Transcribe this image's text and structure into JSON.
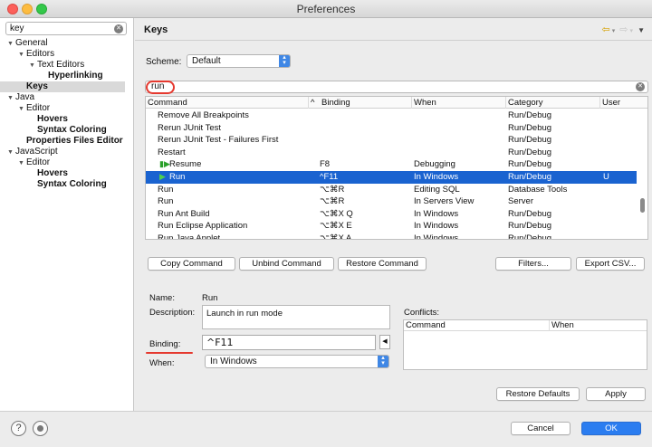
{
  "window": {
    "title": "Preferences"
  },
  "left": {
    "filter_value": "key",
    "tree": [
      {
        "label": "General",
        "indent": 0,
        "tri": "▼",
        "bold": false
      },
      {
        "label": "Editors",
        "indent": 1,
        "tri": "▼",
        "bold": false
      },
      {
        "label": "Text Editors",
        "indent": 2,
        "tri": "▼",
        "bold": false
      },
      {
        "label": "Hyperlinking",
        "indent": 3,
        "tri": "",
        "bold": true
      },
      {
        "label": "Keys",
        "indent": 1,
        "tri": "",
        "bold": true
      },
      {
        "label": "Java",
        "indent": 0,
        "tri": "▼",
        "bold": false
      },
      {
        "label": "Editor",
        "indent": 1,
        "tri": "▼",
        "bold": false
      },
      {
        "label": "Hovers",
        "indent": 2,
        "tri": "",
        "bold": true
      },
      {
        "label": "Syntax Coloring",
        "indent": 2,
        "tri": "",
        "bold": true
      },
      {
        "label": "Properties Files Editor",
        "indent": 1,
        "tri": "",
        "bold": true
      },
      {
        "label": "JavaScript",
        "indent": 0,
        "tri": "▼",
        "bold": false
      },
      {
        "label": "Editor",
        "indent": 1,
        "tri": "▼",
        "bold": false
      },
      {
        "label": "Hovers",
        "indent": 2,
        "tri": "",
        "bold": true
      },
      {
        "label": "Syntax Coloring",
        "indent": 2,
        "tri": "",
        "bold": true
      }
    ]
  },
  "main": {
    "title": "Keys",
    "scheme_label": "Scheme:",
    "scheme_value": "Default",
    "search_value": "run",
    "columns": [
      "Command",
      "Binding",
      "When",
      "Category",
      "User"
    ],
    "rows": [
      {
        "command": "Remove All Breakpoints",
        "binding": "",
        "when": "",
        "category": "Run/Debug",
        "user": ""
      },
      {
        "command": "Rerun JUnit Test",
        "binding": "",
        "when": "",
        "category": "Run/Debug",
        "user": ""
      },
      {
        "command": "Rerun JUnit Test - Failures First",
        "binding": "",
        "when": "",
        "category": "Run/Debug",
        "user": ""
      },
      {
        "command": "Restart",
        "binding": "",
        "when": "",
        "category": "Run/Debug",
        "user": ""
      },
      {
        "command": "Resume",
        "binding": "F8",
        "when": "Debugging",
        "category": "Run/Debug",
        "user": ""
      },
      {
        "command": "Run",
        "binding": "^F11",
        "when": "In Windows",
        "category": "Run/Debug",
        "user": "U"
      },
      {
        "command": "Run",
        "binding": "⌥⌘R",
        "when": "Editing SQL",
        "category": "Database Tools",
        "user": ""
      },
      {
        "command": "Run",
        "binding": "⌥⌘R",
        "when": "In Servers View",
        "category": "Server",
        "user": ""
      },
      {
        "command": "Run Ant Build",
        "binding": "⌥⌘X Q",
        "when": "In Windows",
        "category": "Run/Debug",
        "user": ""
      },
      {
        "command": "Run Eclipse Application",
        "binding": "⌥⌘X E",
        "when": "In Windows",
        "category": "Run/Debug",
        "user": ""
      },
      {
        "command": "Run Java Applet",
        "binding": "⌥⌘X A",
        "when": "In Windows",
        "category": "Run/Debug",
        "user": ""
      }
    ],
    "buttons": {
      "copy_command": "Copy Command",
      "unbind_command": "Unbind Command",
      "restore_command": "Restore Command",
      "filters": "Filters...",
      "export_csv": "Export CSV..."
    },
    "details": {
      "name_label": "Name:",
      "name_value": "Run",
      "description_label": "Description:",
      "description_value": "Launch in run mode",
      "binding_label": "Binding:",
      "binding_value": "^F11",
      "when_label": "When:",
      "when_value": "In Windows"
    },
    "conflicts": {
      "label": "Conflicts:",
      "columns": [
        "Command",
        "When"
      ]
    },
    "restore_defaults": "Restore Defaults",
    "apply": "Apply"
  },
  "footer": {
    "help_icon": "?",
    "cancel": "Cancel",
    "ok": "OK"
  },
  "colors": {
    "selection": "#1a63d0",
    "annotation_red": "#e5392f",
    "primary_button": "#2b7df0"
  }
}
